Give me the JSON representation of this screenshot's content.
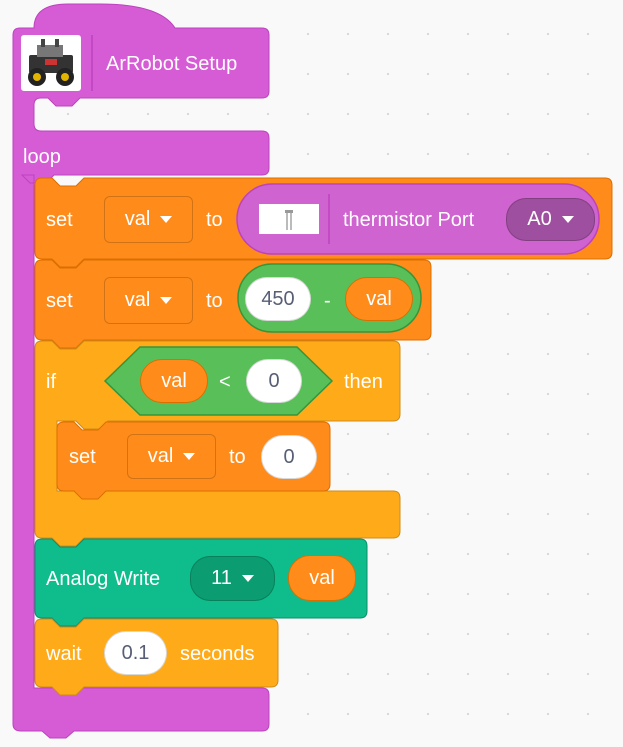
{
  "hat": {
    "title": "ArRobot Setup"
  },
  "loop": {
    "label": "loop"
  },
  "set1": {
    "set": "set",
    "var": "val",
    "to": "to",
    "reporter_label": "thermistor Port",
    "port": "A0"
  },
  "set2": {
    "set": "set",
    "var": "val",
    "to": "to",
    "left": "450",
    "op": "-",
    "right": "val"
  },
  "if_block": {
    "if": "if",
    "left": "val",
    "op": "<",
    "right": "0",
    "then": "then"
  },
  "set3": {
    "set": "set",
    "var": "val",
    "to": "to",
    "value": "0"
  },
  "analog": {
    "label": "Analog Write",
    "pin": "11",
    "value": "val"
  },
  "wait": {
    "label": "wait",
    "value": "0.1",
    "unit": "seconds"
  },
  "colors": {
    "loop": "#d65cd6",
    "data": "#ff8c1a",
    "control": "#ffab19",
    "operator": "#59c059",
    "analog": "#0fbd8c",
    "sensor": "#cf63cf"
  }
}
